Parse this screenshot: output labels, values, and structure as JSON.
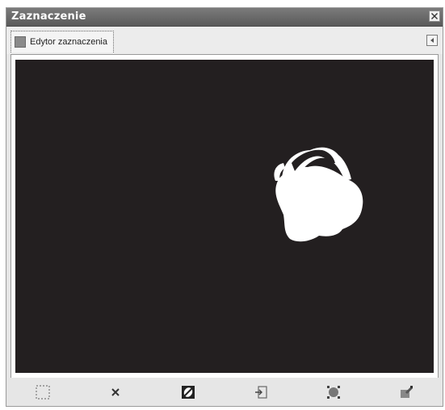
{
  "window": {
    "title": "Zaznaczenie"
  },
  "tabs": [
    {
      "label": "Edytor zaznaczenia",
      "icon": "selection-editor-icon",
      "active": true
    }
  ],
  "toolbar": {
    "buttons": [
      {
        "name": "select-all-button",
        "icon": "select-all-icon"
      },
      {
        "name": "select-none-button",
        "icon": "select-none-icon"
      },
      {
        "name": "invert-selection-button",
        "icon": "invert-selection-icon"
      },
      {
        "name": "save-to-channel-button",
        "icon": "save-to-channel-icon"
      },
      {
        "name": "selection-to-path-button",
        "icon": "selection-to-path-icon"
      },
      {
        "name": "stroke-selection-button",
        "icon": "stroke-selection-icon"
      }
    ]
  },
  "colors": {
    "titlebar": "#6a6a6a",
    "canvas_background": "#231f20",
    "selection_mask": "#ffffff"
  }
}
